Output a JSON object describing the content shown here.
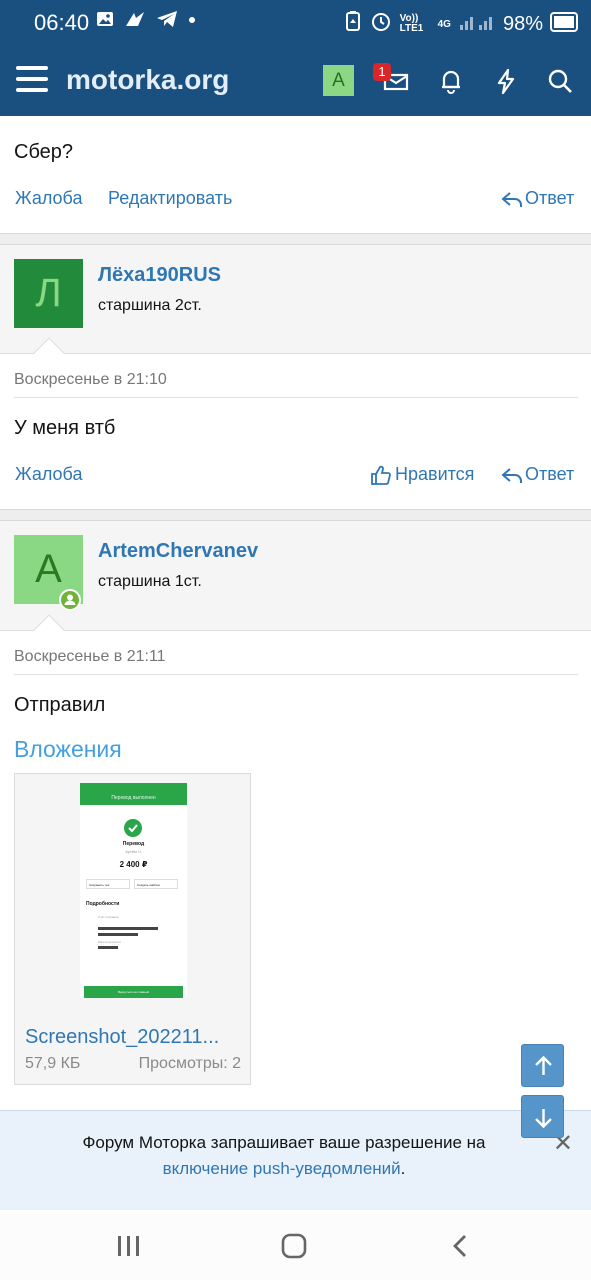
{
  "status_bar": {
    "time": "06:40",
    "network": "Vo)) LTE1",
    "net_type": "4G",
    "battery": "98%"
  },
  "header": {
    "site_name": "motorka.org",
    "avatar_letter": "A",
    "inbox_badge": "1"
  },
  "post_top": {
    "text": "Сбер?",
    "actions": {
      "report": "Жалоба",
      "edit": "Редактировать",
      "reply": "Ответ"
    }
  },
  "post2": {
    "avatar_letter": "Л",
    "username": "Лёха190RUS",
    "rank": "старшина 2ст.",
    "datetime": "Воскресенье в 21:10",
    "text": "У меня втб",
    "actions": {
      "report": "Жалоба",
      "like": "Нравится",
      "reply": "Ответ"
    }
  },
  "post3": {
    "avatar_letter": "A",
    "username": "ArtemChervanev",
    "rank": "старшина 1ст.",
    "datetime": "Воскресенье в 21:11",
    "text": "Отправил",
    "attachments_heading": "Вложения",
    "attachment": {
      "name": "Screenshot_202211...",
      "size": "57,9 КБ",
      "views": "Просмотры: 2"
    },
    "thumbnail": {
      "header_title": "Перевод выполнен",
      "title": "Перевод",
      "subtitle": "Артём Ч.",
      "amount": "2 400 ₽",
      "btn1": "Сохранить чек",
      "btn2": "Создать шаблон",
      "section": "Подробности",
      "row1": "Счёт списания",
      "row2": "Имя получателя",
      "button": "Вернуться на главный"
    }
  },
  "push_banner": {
    "line1": "Форум Моторка запрашивает ваше разрешение на",
    "link": "включение push-уведомлений",
    "suffix": "."
  },
  "colors": {
    "navbar": "#1a5080",
    "link": "#2f77b4",
    "accent_blue": "#45a0dc",
    "avatar_dark_green": "#228b3b",
    "avatar_light_green": "#8ad884"
  }
}
